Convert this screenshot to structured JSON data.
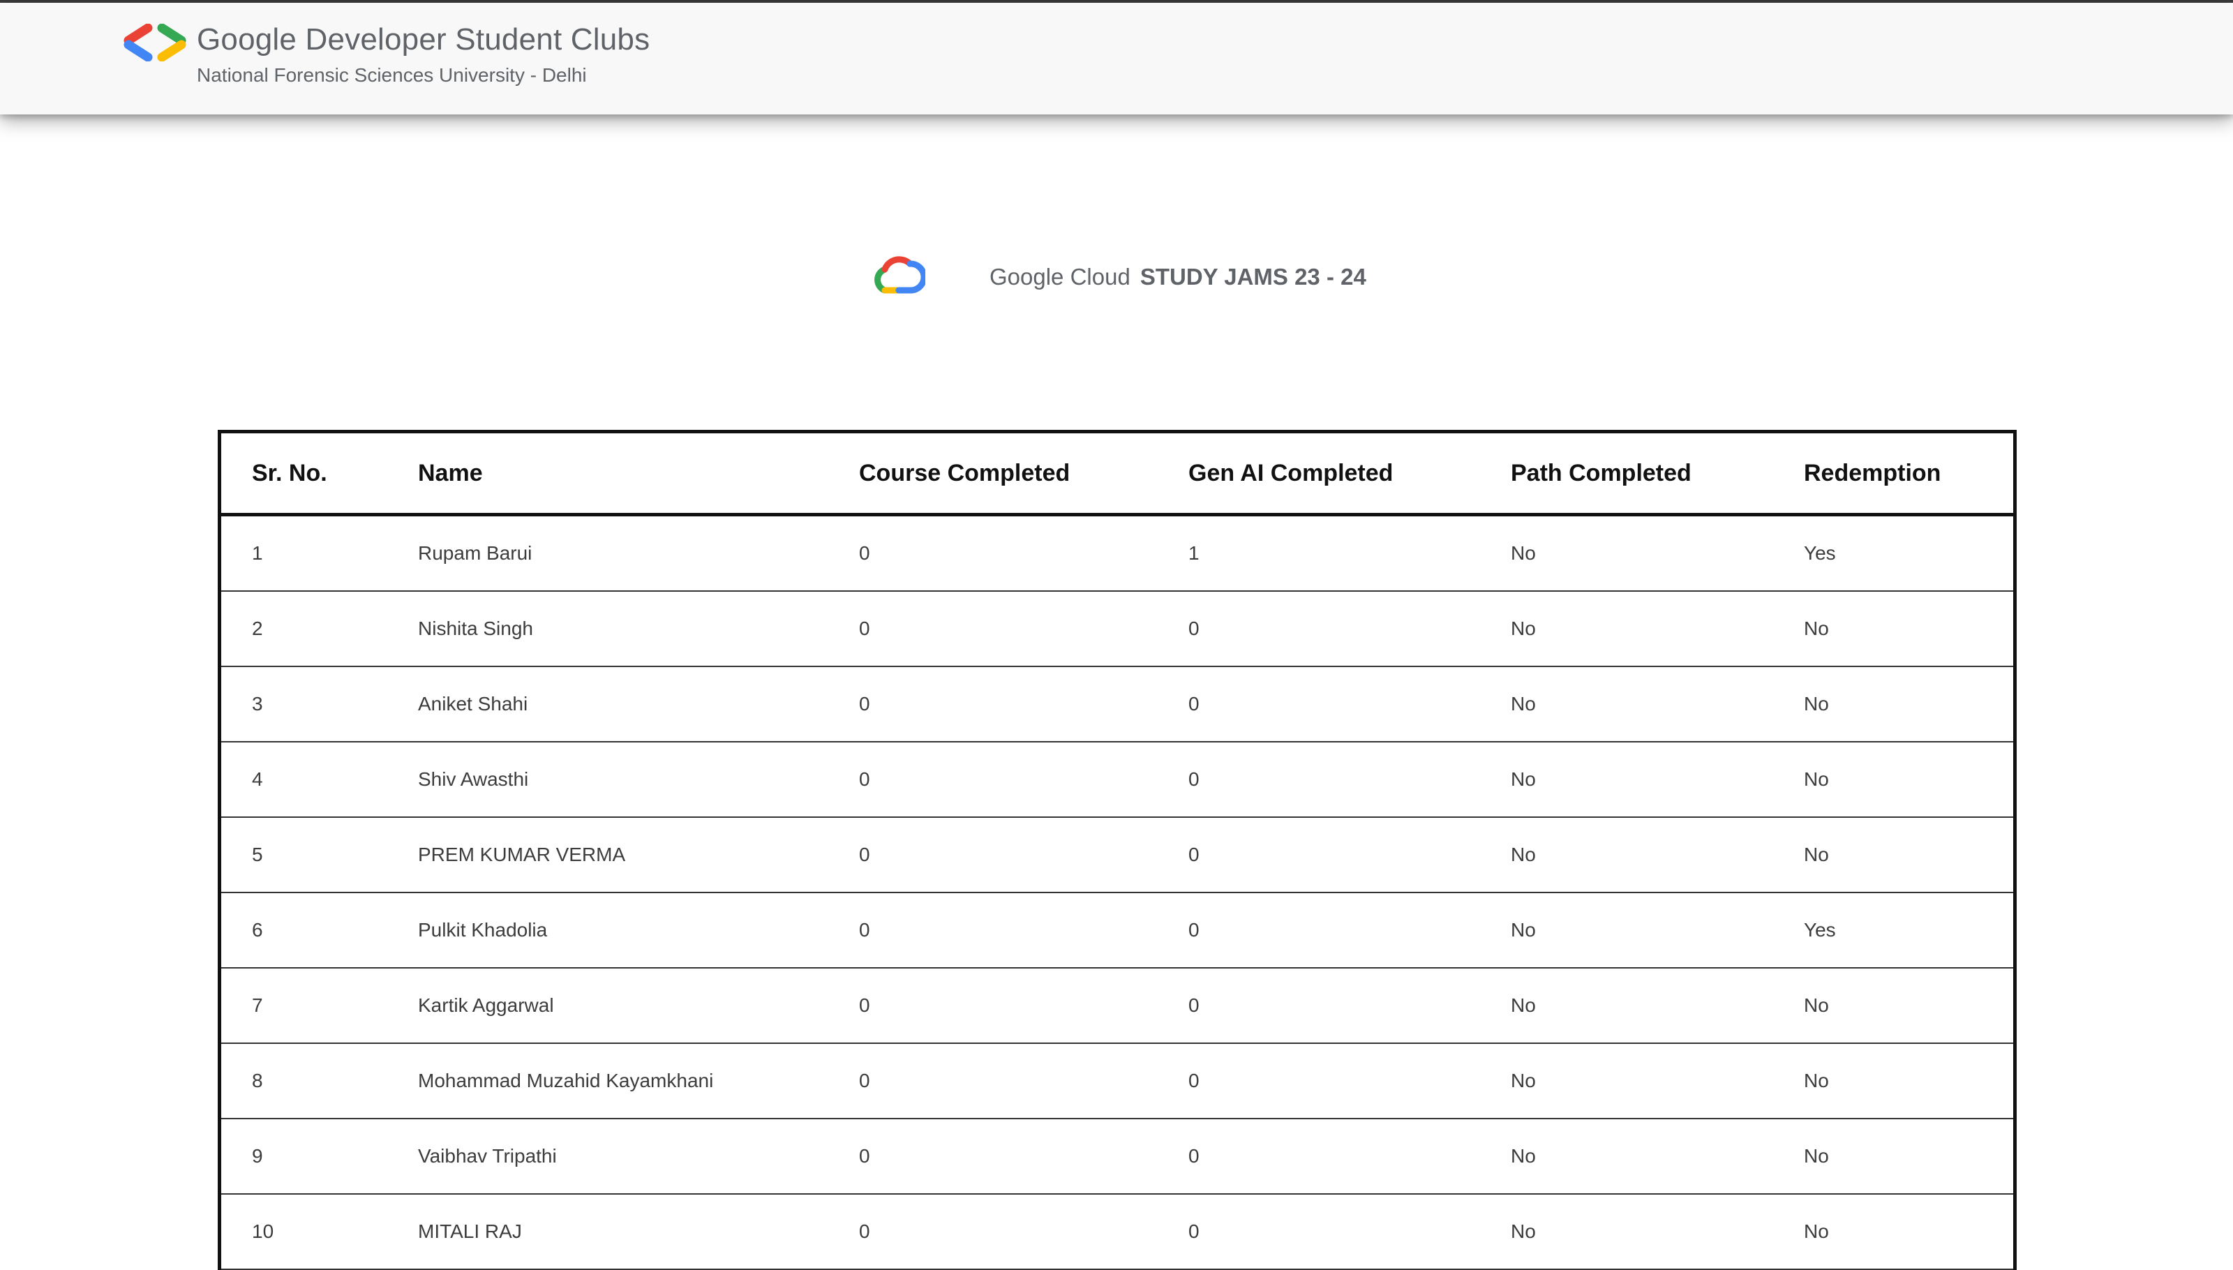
{
  "header": {
    "title": "Google Developer Student Clubs",
    "subtitle": "National Forensic Sciences University - Delhi",
    "logo_icon": "gdsc-brackets-icon"
  },
  "hero": {
    "cloud_icon": "google-cloud-icon",
    "brand": "Google Cloud",
    "event": "STUDY JAMS 23 - 24"
  },
  "colors": {
    "google_blue": "#4285F4",
    "google_red": "#EA4335",
    "google_yellow": "#FBBC04",
    "google_green": "#34A853",
    "text_grey": "#5f6368"
  },
  "table": {
    "columns": [
      "Sr. No.",
      "Name",
      "Course Completed",
      "Gen AI Completed",
      "Path Completed",
      "Redemption"
    ],
    "rows": [
      [
        "1",
        "Rupam Barui",
        "0",
        "1",
        "No",
        "Yes"
      ],
      [
        "2",
        "Nishita Singh",
        "0",
        "0",
        "No",
        "No"
      ],
      [
        "3",
        "Aniket Shahi",
        "0",
        "0",
        "No",
        "No"
      ],
      [
        "4",
        "Shiv Awasthi",
        "0",
        "0",
        "No",
        "No"
      ],
      [
        "5",
        "PREM KUMAR VERMA",
        "0",
        "0",
        "No",
        "No"
      ],
      [
        "6",
        "Pulkit Khadolia",
        "0",
        "0",
        "No",
        "Yes"
      ],
      [
        "7",
        "Kartik Aggarwal",
        "0",
        "0",
        "No",
        "No"
      ],
      [
        "8",
        "Mohammad Muzahid Kayamkhani",
        "0",
        "0",
        "No",
        "No"
      ],
      [
        "9",
        "Vaibhav Tripathi",
        "0",
        "0",
        "No",
        "No"
      ],
      [
        "10",
        "MITALI RAJ",
        "0",
        "0",
        "No",
        "No"
      ]
    ]
  }
}
